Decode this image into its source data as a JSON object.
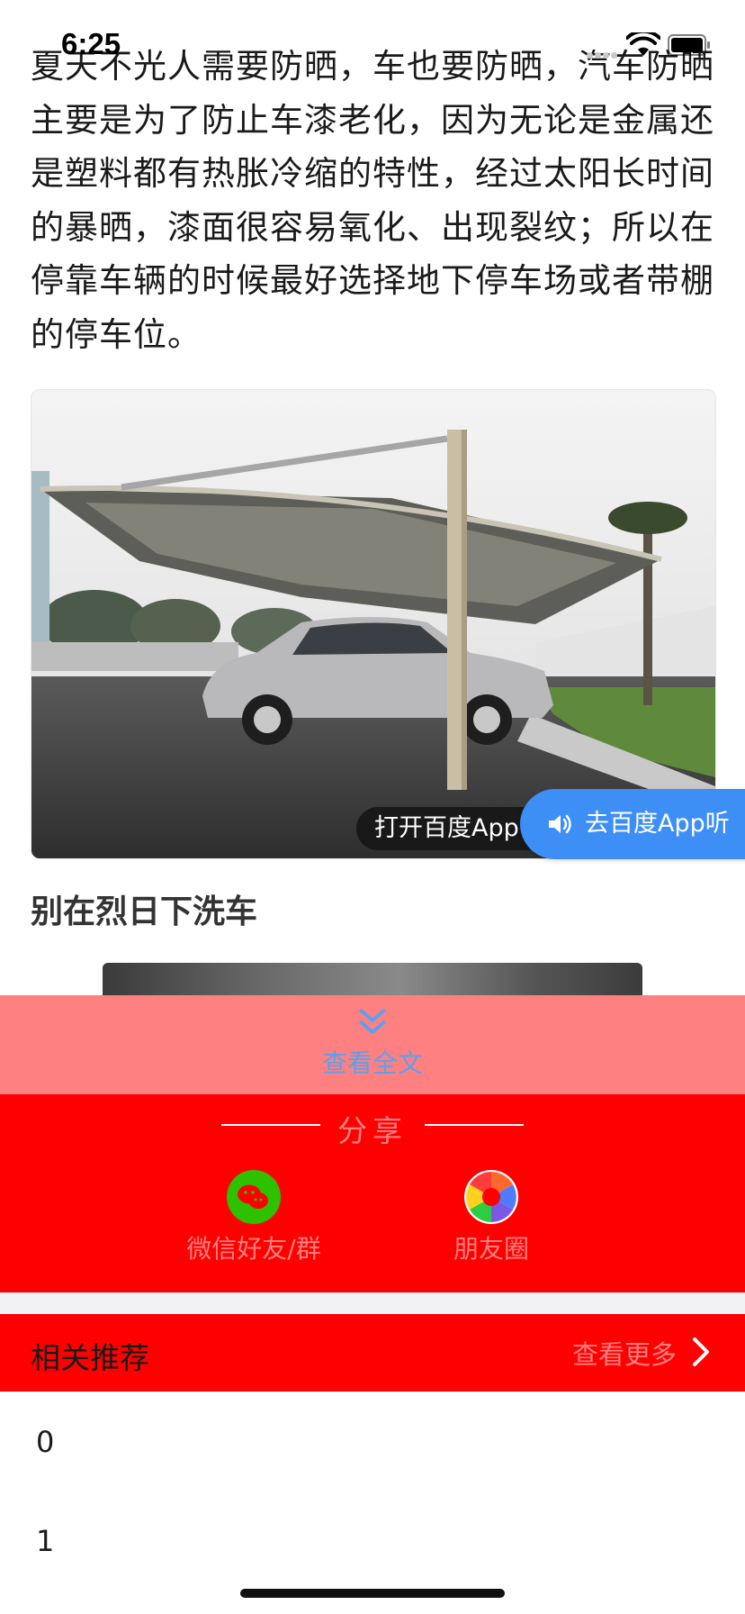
{
  "status_bar": {
    "time": "6:25"
  },
  "article": {
    "paragraph": "夏天不光人需要防晒，车也要防晒，汽车防晒主要是为了防止车漆老化，因为无论是金属还是塑料都有热胀冷缩的特性，经过太阳长时间的暴晒，漆面很容易氧化、出现裂纹；所以在停靠车辆的时候最好选择地下停车场或者带棚的停车位。",
    "open_app_label": "打开百度App",
    "listen_label": "去百度App听",
    "section_heading": "别在烈日下洗车"
  },
  "view_full": {
    "label": "查看全文"
  },
  "share": {
    "title": "分享",
    "items": [
      {
        "label": "微信好友/群",
        "icon": "wechat-icon"
      },
      {
        "label": "朋友圈",
        "icon": "moments-icon"
      }
    ]
  },
  "related": {
    "title": "相关推荐",
    "more_label": "查看更多",
    "items": [
      "0",
      "1"
    ]
  },
  "colors": {
    "share_bg": "#ff0000",
    "view_full_bg": "#ff8080",
    "accent_blue": "#3d8ef5",
    "muted_label": "#ff8080"
  }
}
